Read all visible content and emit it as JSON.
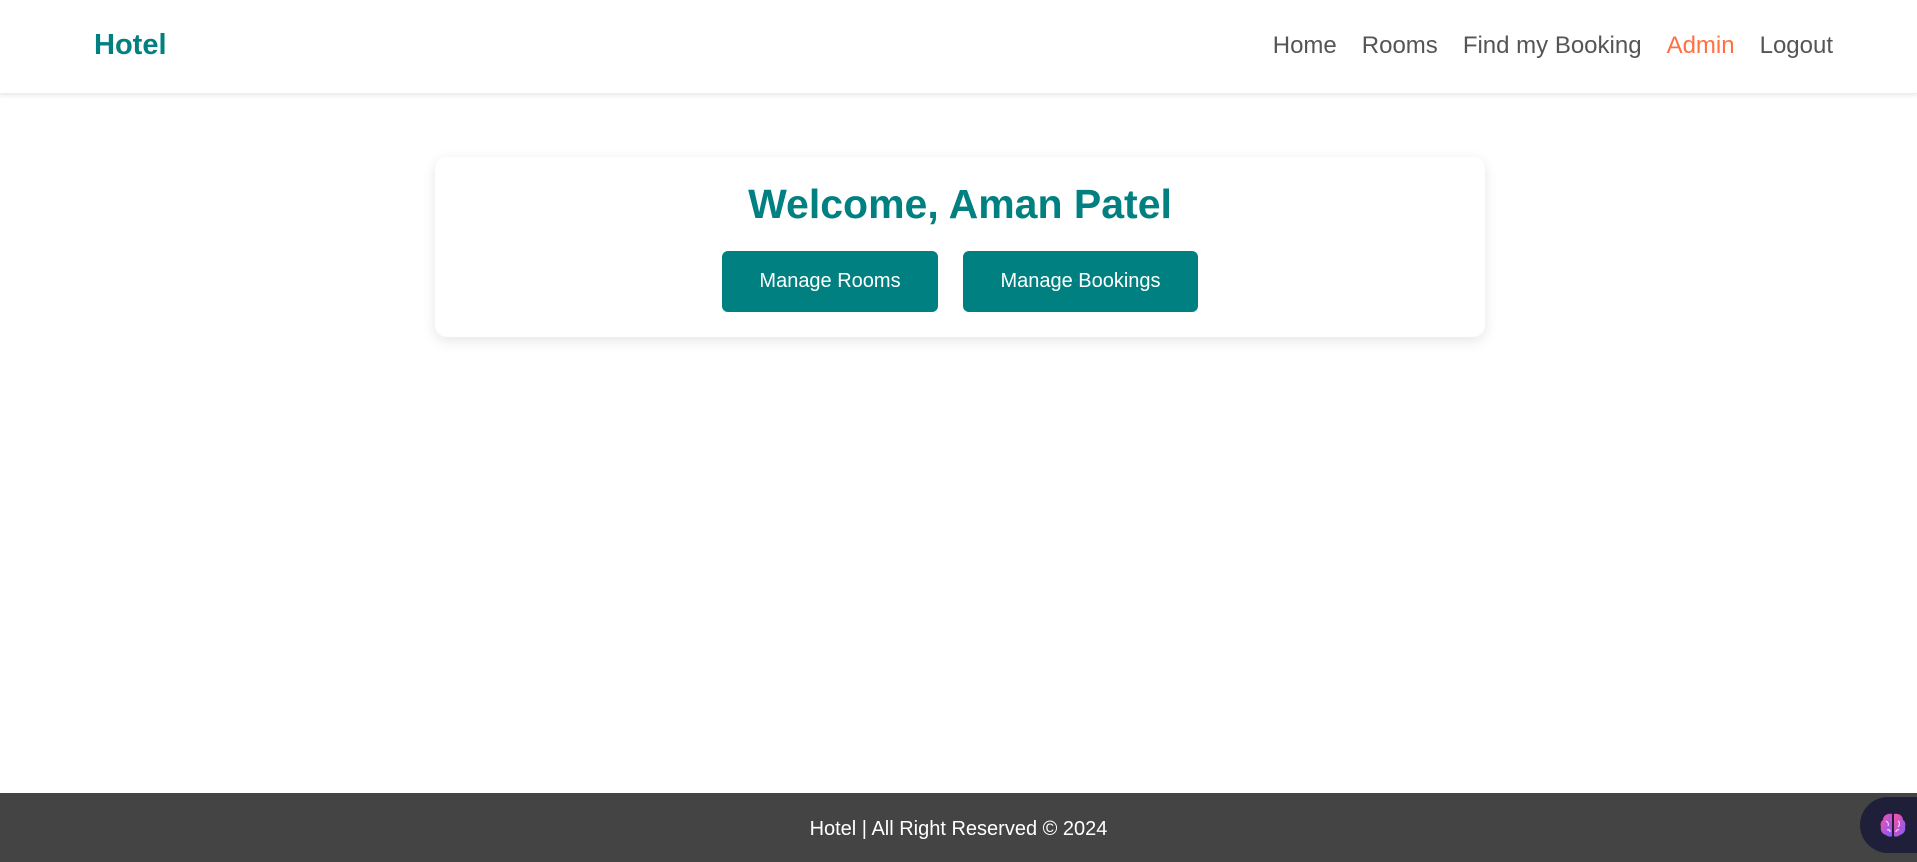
{
  "header": {
    "brand": "Hotel",
    "nav": {
      "home": "Home",
      "rooms": "Rooms",
      "find_booking": "Find my Booking",
      "admin": "Admin",
      "logout": "Logout"
    }
  },
  "main": {
    "welcome_prefix": "Welcome,",
    "user_name": "Aman Patel",
    "manage_rooms_label": "Manage Rooms",
    "manage_bookings_label": "Manage Bookings"
  },
  "footer": {
    "text": "Hotel | All Right Reserved © 2024"
  },
  "widget": {
    "icon": "brain-icon"
  },
  "colors": {
    "brand": "#008080",
    "active_nav": "#ff7043",
    "nav_text": "#555555",
    "footer_bg": "#444444"
  }
}
